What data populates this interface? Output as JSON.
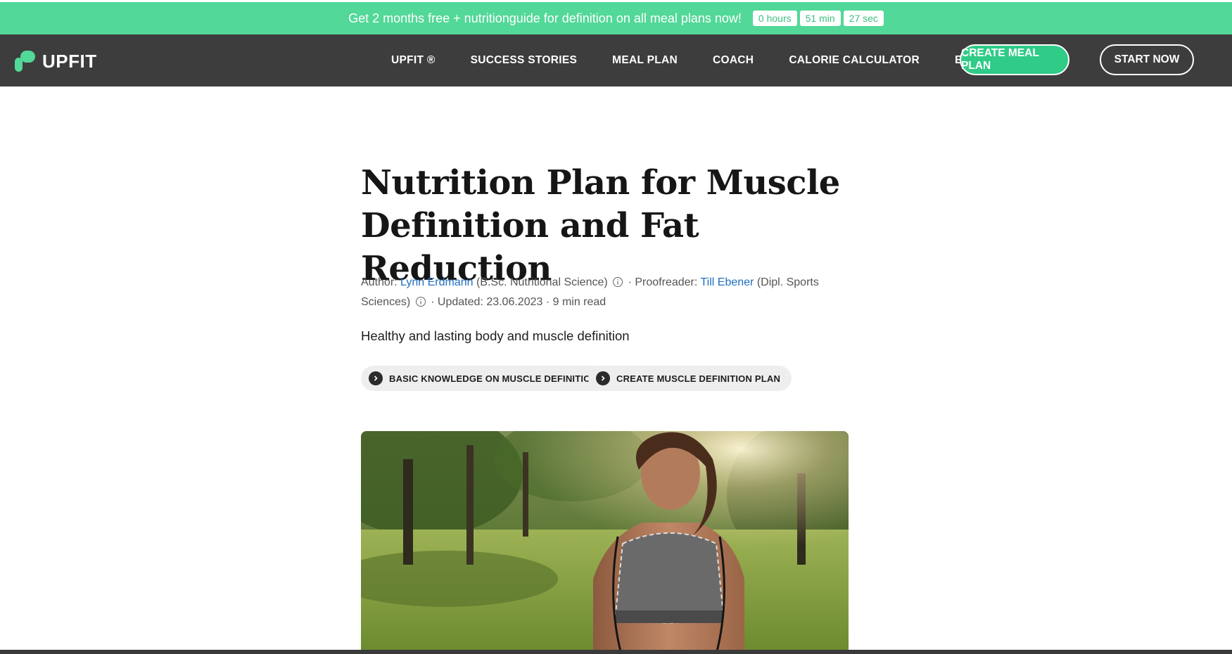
{
  "promo": {
    "text": "Get 2 months free + nutritionguide for definition on all meal plans now!",
    "timer": [
      "0 hours",
      "51 min",
      "27 sec"
    ]
  },
  "nav": {
    "logo": "UPFIT",
    "links": [
      "UPFIT ®",
      "SUCCESS STORIES",
      "MEAL PLAN",
      "COACH",
      "CALORIE CALCULATOR"
    ],
    "language": "EN",
    "create_button": "CREATE MEAL PLAN",
    "start_button": "START NOW"
  },
  "article": {
    "title": "Nutrition Plan for Muscle Definition and Fat Reduction",
    "meta": {
      "author_label": "Author:",
      "author_name": "Lynn Erdmann",
      "author_credential": "(B.Sc. Nutritional Science)",
      "proofreader_label": "· Proofreader:",
      "proofreader_name": "Till Ebener",
      "proofreader_credential": "(Dipl. Sports Sciences)",
      "updated": "· Updated: 23.06.2023 · 9 min read"
    },
    "subtitle": "Healthy and lasting body and muscle definition",
    "pills": [
      "BASIC KNOWLEDGE ON MUSCLE DEFINITION",
      "CREATE MUSCLE DEFINITION PLAN"
    ]
  },
  "colors": {
    "brand_green": "#52d898",
    "button_green": "#2fcb87",
    "nav_bg": "#3d3d3d",
    "link_blue": "#1f6fc0"
  }
}
